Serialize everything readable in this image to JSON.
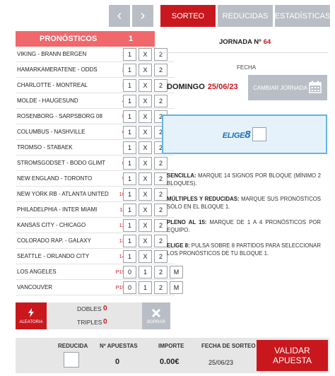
{
  "nav": {
    "prev": "‹",
    "next": "›"
  },
  "tabs": [
    {
      "label": "SORTEO"
    },
    {
      "label": "REDUCIDAS"
    },
    {
      "label": "ESTADÍSTICAS"
    }
  ],
  "pronosticos": {
    "title": "PRONÓSTICOS",
    "count": "1"
  },
  "options": {
    "one": "1",
    "x": "X",
    "two": "2",
    "m": "M"
  },
  "matches": [
    {
      "team": "VIKING - BRANN BERGEN",
      "num": "1"
    },
    {
      "team": "HAMARKAMERATENE - ODDS",
      "num": "2"
    },
    {
      "team": "CHARLOTTE - MONTREAL",
      "num": "3"
    },
    {
      "team": "MOLDE - HAUGESUND",
      "num": "4"
    },
    {
      "team": "ROSENBORG - SARPSBORG 08",
      "num": "5"
    },
    {
      "team": "COLUMBUS - NASHVILLE",
      "num": "6"
    },
    {
      "team": "TROMSO - STABAEK",
      "num": "7"
    },
    {
      "team": "STROMSGODSET - BODO GLIMT",
      "num": "8"
    },
    {
      "team": "NEW ENGLAND - TORONTO",
      "num": "9"
    },
    {
      "team": "NEW YORK RB - ATLANTA UNITED",
      "num": "10"
    },
    {
      "team": "PHILADELPHIA - INTER MIAMI",
      "num": "11"
    },
    {
      "team": "KANSAS CITY - CHICAGO",
      "num": "12"
    },
    {
      "team": "COLORADO RAP. - GALAXY",
      "num": "13"
    },
    {
      "team": "SEATTLE - ORLANDO CITY",
      "num": "14"
    }
  ],
  "pleno": [
    {
      "team": "LOS ANGELES",
      "num": "P15",
      "opts": [
        "0",
        "1",
        "2",
        "M"
      ]
    },
    {
      "team": "VANCOUVER",
      "num": "P15",
      "opts": [
        "0",
        "1",
        "2",
        "M"
      ]
    }
  ],
  "tools": {
    "aleatoria_icon": "lightning-icon",
    "aleatoria_label": "ALEATORIA",
    "dobles_label": "DOBLES",
    "dobles_value": "0",
    "triples_label": "TRIPLES",
    "triples_value": "0",
    "borrar_icon": "close-icon",
    "borrar_label": "BORRAR"
  },
  "jornada": {
    "label": "JORNADA Nº",
    "number": "64"
  },
  "fecha": {
    "label": "FECHA",
    "day": "DOMINGO",
    "date": "25/06/23",
    "change_button": "CAMBIAR JORNADA",
    "calendar_icon": "calendar-icon"
  },
  "elige8": {
    "logo_text": "ELIGE",
    "logo_number": "8"
  },
  "info": {
    "sencilla_title": "SENCILLA:",
    "sencilla_text": "MARQUE 14 SIGNOS POR BLOQUE (MÍNIMO 2 BLOQUES).",
    "multiples_title": "MÚLTIPLES Y REDUCIDAS:",
    "multiples_text": "MARQUE SUS PRONÓSTICOS SÓLO EN EL BLOQUE 1.",
    "pleno_title": "PLENO AL 15:",
    "pleno_text": "MARQUE DE 1 A 4 PRONÓSTICOS POR EQUIPO.",
    "elige_title": "ELIGE 8:",
    "elige_text": "PULSA SOBRE 8 PARTIDOS PARA SELECCIONAR LOS PRONÓSTICOS DE TU BLOQUE 1."
  },
  "footer": {
    "reducida_label": "REDUCIDA",
    "apuestas_label": "Nº APUESTAS",
    "apuestas_value": "0",
    "importe_label": "IMPORTE",
    "importe_value": "0.00€",
    "fecha_label": "FECHA DE SORTEO",
    "fecha_value": "25/06/23",
    "validar_line1": "VALIDAR",
    "validar_line2": "APUESTA"
  },
  "colors": {
    "accent": "#c8181e",
    "header_pink": "#f0686c",
    "neutral_button": "#b9bec6",
    "elige_blue": "#1f6fb5"
  }
}
